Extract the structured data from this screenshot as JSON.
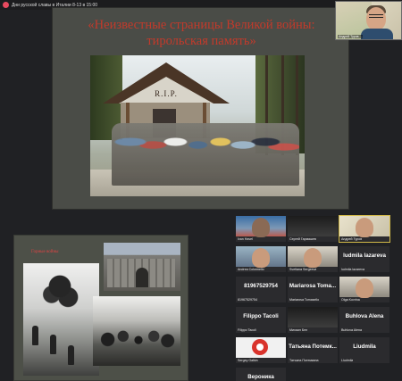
{
  "window": {
    "title": "Дни русской славы в Италии 8-13 в 15:00"
  },
  "main_slide": {
    "title_line1": "«Неизвестные страницы Великой войны:",
    "title_line2": "тирольская память»",
    "photo_sign": "R.I.P."
  },
  "self_view": {
    "label": "Андрей Туров ..."
  },
  "second_slide": {
    "caption": "Горные войны"
  },
  "participants": [
    {
      "name": "Ivan Havel",
      "display": "",
      "video": "v-blue"
    },
    {
      "name": "Сергей Гармашев",
      "display": "",
      "video": "v-dark"
    },
    {
      "name": "Андрей Туров",
      "display": "",
      "video": "v-map",
      "active": true
    },
    {
      "name": "Andrea Colonnello",
      "display": "",
      "video": "v-people"
    },
    {
      "name": "Svetlana Sergeeva",
      "display": "",
      "video": "v-room"
    },
    {
      "name": "ludmila lazareva",
      "display": "ludmila lazareva",
      "video": ""
    },
    {
      "name": "81967529754",
      "display": "81967529754",
      "video": ""
    },
    {
      "name": "Mariarosa Tomasello",
      "display": "Mariarosa Toma...",
      "video": ""
    },
    {
      "name": "Olga Kovrina",
      "display": "",
      "video": "v-room"
    },
    {
      "name": "Filippo Tacoli",
      "display": "Filippo Tacoli",
      "video": ""
    },
    {
      "name": "Михаил Бел",
      "display": "",
      "video": "v-dark"
    },
    {
      "name": "Buhlova Alena",
      "display": "Buhlova Alena",
      "video": ""
    },
    {
      "name": "Sergey Galkin",
      "display": "",
      "video": "v-red"
    },
    {
      "name": "Татьяна Потемкина",
      "display": "Татьяна Потемк...",
      "video": ""
    },
    {
      "name": "Liudmila",
      "display": "Liudmila",
      "video": ""
    },
    {
      "name": "Вероника",
      "display": "Вероника",
      "video": ""
    }
  ]
}
